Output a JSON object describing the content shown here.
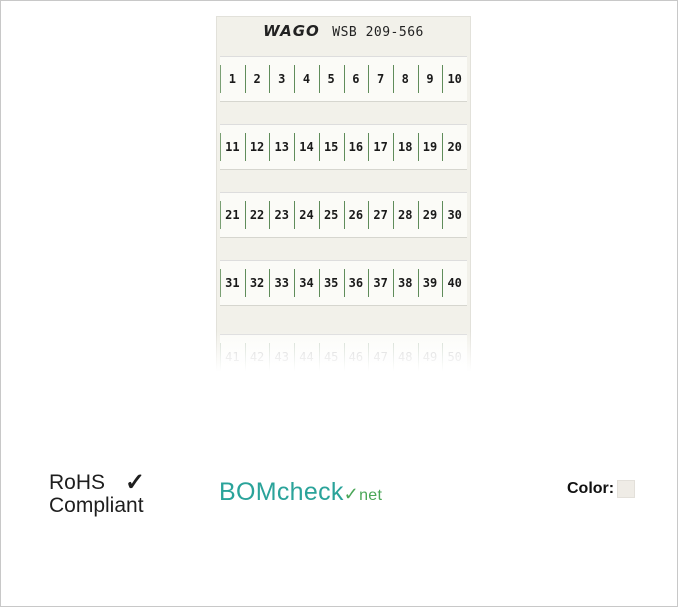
{
  "product": {
    "brand": "WAGO",
    "model": "WSB 209-566",
    "rows": [
      [
        "1",
        "2",
        "3",
        "4",
        "5",
        "6",
        "7",
        "8",
        "9",
        "10"
      ],
      [
        "11",
        "12",
        "13",
        "14",
        "15",
        "16",
        "17",
        "18",
        "19",
        "20"
      ],
      [
        "21",
        "22",
        "23",
        "24",
        "25",
        "26",
        "27",
        "28",
        "29",
        "30"
      ],
      [
        "31",
        "32",
        "33",
        "34",
        "35",
        "36",
        "37",
        "38",
        "39",
        "40"
      ],
      [
        "41",
        "42",
        "43",
        "44",
        "45",
        "46",
        "47",
        "48",
        "49",
        "50"
      ]
    ]
  },
  "compliance": {
    "rohs_line1": "RoHS",
    "rohs_line2": "Compliant",
    "check_icon": "check-icon"
  },
  "bomcheck": {
    "part1": "BOM",
    "part2": "check",
    "check_glyph": "✓",
    "part3": "net"
  },
  "color": {
    "label": "Color:",
    "value_hex": "#efece6"
  }
}
